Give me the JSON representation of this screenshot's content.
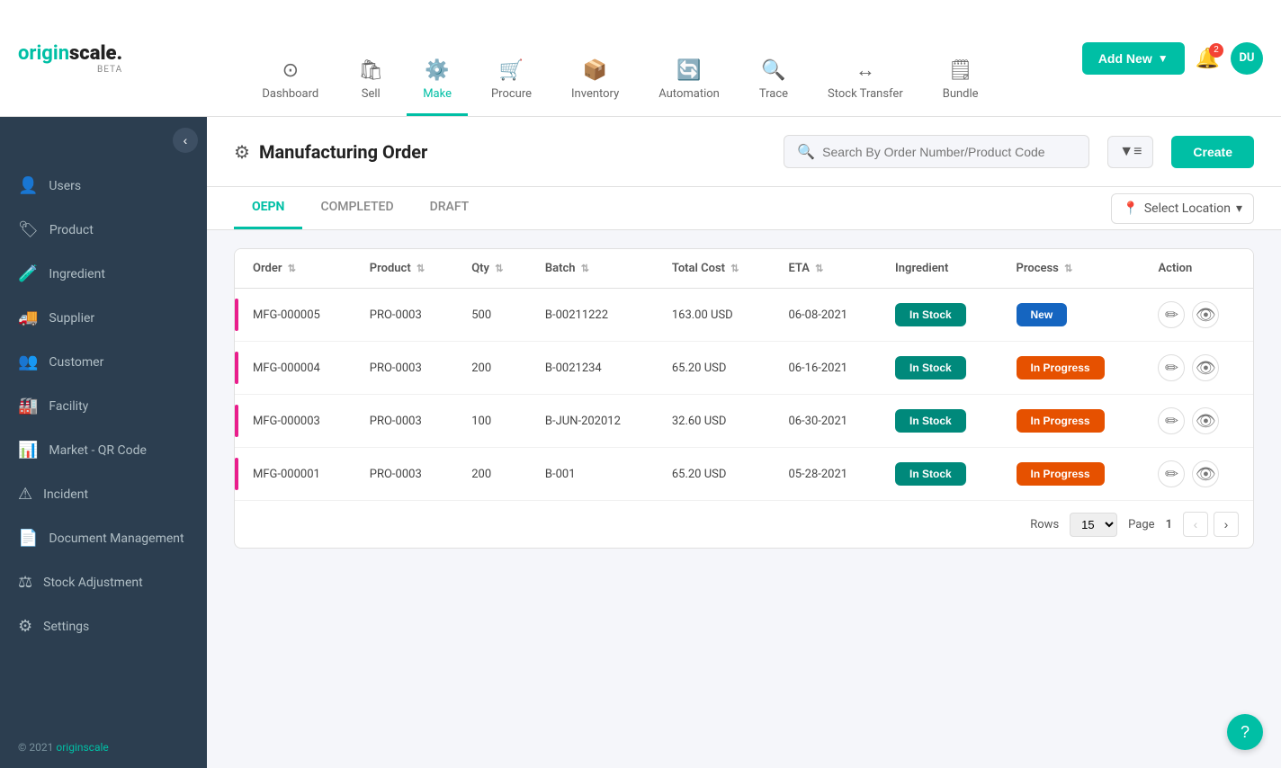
{
  "app": {
    "name_start": "origin",
    "name_end": "scale.",
    "beta": "BETA"
  },
  "topnav": {
    "items": [
      {
        "id": "dashboard",
        "label": "Dashboard",
        "icon": "⊙",
        "active": false
      },
      {
        "id": "sell",
        "label": "Sell",
        "icon": "🛍",
        "active": false
      },
      {
        "id": "make",
        "label": "Make",
        "icon": "⚙️",
        "active": true
      },
      {
        "id": "procure",
        "label": "Procure",
        "icon": "🛒",
        "active": false
      },
      {
        "id": "inventory",
        "label": "Inventory",
        "icon": "📦",
        "active": false
      },
      {
        "id": "automation",
        "label": "Automation",
        "icon": "🔄",
        "active": false
      },
      {
        "id": "trace",
        "label": "Trace",
        "icon": "🔍",
        "active": false
      },
      {
        "id": "stock-transfer",
        "label": "Stock Transfer",
        "icon": "↔",
        "active": false
      },
      {
        "id": "bundle",
        "label": "Bundle",
        "icon": "🗒",
        "active": false
      }
    ],
    "add_new": "Add New",
    "notif_count": "2",
    "avatar": "DU"
  },
  "sidebar": {
    "items": [
      {
        "id": "users",
        "label": "Users",
        "icon": "👤"
      },
      {
        "id": "product",
        "label": "Product",
        "icon": "🏷"
      },
      {
        "id": "ingredient",
        "label": "Ingredient",
        "icon": "🧪"
      },
      {
        "id": "supplier",
        "label": "Supplier",
        "icon": "🚚"
      },
      {
        "id": "customer",
        "label": "Customer",
        "icon": "👥"
      },
      {
        "id": "facility",
        "label": "Facility",
        "icon": "🏭"
      },
      {
        "id": "market-qr",
        "label": "Market - QR Code",
        "icon": "📊"
      },
      {
        "id": "incident",
        "label": "Incident",
        "icon": "⚠"
      },
      {
        "id": "document-mgmt",
        "label": "Document Management",
        "icon": "📄"
      },
      {
        "id": "stock-adjustment",
        "label": "Stock Adjustment",
        "icon": "⚖"
      },
      {
        "id": "settings",
        "label": "Settings",
        "icon": "⚙"
      }
    ],
    "footer_copy": "© 2021",
    "footer_link": "originscale"
  },
  "page": {
    "title": "Manufacturing Order",
    "icon": "⚙",
    "search_placeholder": "Search By Order Number/Product Code",
    "create_label": "Create"
  },
  "tabs": {
    "items": [
      {
        "id": "oepn",
        "label": "OEPN",
        "active": true
      },
      {
        "id": "completed",
        "label": "COMPLETED",
        "active": false
      },
      {
        "id": "draft",
        "label": "DRAFT",
        "active": false
      }
    ],
    "select_location": "Select Location"
  },
  "table": {
    "columns": [
      {
        "id": "order",
        "label": "Order"
      },
      {
        "id": "product",
        "label": "Product"
      },
      {
        "id": "qty",
        "label": "Qty"
      },
      {
        "id": "batch",
        "label": "Batch"
      },
      {
        "id": "total-cost",
        "label": "Total Cost"
      },
      {
        "id": "eta",
        "label": "ETA"
      },
      {
        "id": "ingredient",
        "label": "Ingredient"
      },
      {
        "id": "process",
        "label": "Process"
      },
      {
        "id": "action",
        "label": "Action"
      }
    ],
    "rows": [
      {
        "order": "MFG-000005",
        "product": "PRO-0003",
        "qty": "500",
        "batch": "B-00211222",
        "total_cost": "163.00 USD",
        "eta": "06-08-2021",
        "ingredient_status": "In Stock",
        "process_status": "New",
        "process_color": "new"
      },
      {
        "order": "MFG-000004",
        "product": "PRO-0003",
        "qty": "200",
        "batch": "B-0021234",
        "total_cost": "65.20 USD",
        "eta": "06-16-2021",
        "ingredient_status": "In Stock",
        "process_status": "In Progress",
        "process_color": "in-progress"
      },
      {
        "order": "MFG-000003",
        "product": "PRO-0003",
        "qty": "100",
        "batch": "B-JUN-202012",
        "total_cost": "32.60 USD",
        "eta": "06-30-2021",
        "ingredient_status": "In Stock",
        "process_status": "In Progress",
        "process_color": "in-progress"
      },
      {
        "order": "MFG-000001",
        "product": "PRO-0003",
        "qty": "200",
        "batch": "B-001",
        "total_cost": "65.20 USD",
        "eta": "05-28-2021",
        "ingredient_status": "In Stock",
        "process_status": "In Progress",
        "process_color": "in-progress"
      }
    ],
    "pagination": {
      "rows_label": "Rows",
      "rows_value": "15",
      "page_label": "Page",
      "page_current": "1"
    }
  }
}
